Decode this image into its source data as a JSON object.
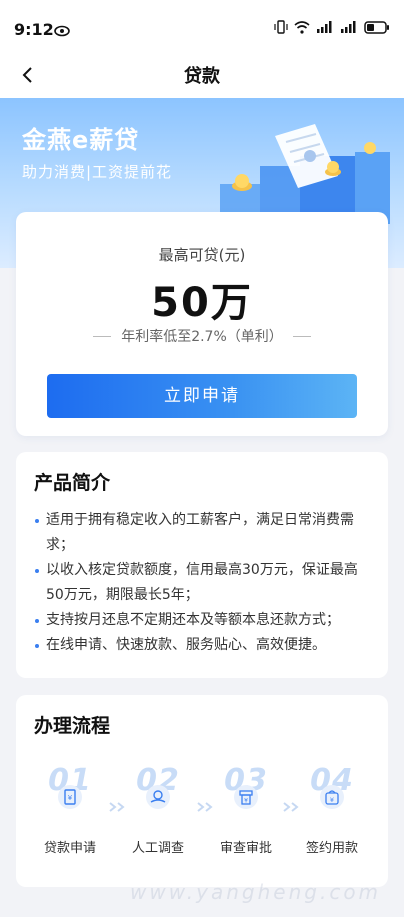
{
  "status": {
    "time": "9:12"
  },
  "nav": {
    "title": "贷款"
  },
  "hero": {
    "title": "金燕e薪贷",
    "subtitle": "助力消费|工资提前花"
  },
  "loan": {
    "label": "最高可贷(元)",
    "amount": "50万",
    "rate": "年利率低至2.7%（单利）",
    "apply_label": "立即申请"
  },
  "intro": {
    "heading": "产品简介",
    "items": [
      "适用于拥有稳定收入的工薪客户，满足日常消费需求；",
      "以收入核定贷款额度，信用最高30万元，保证最高50万元，期限最长5年；",
      "支持按月还息不定期还本及等额本息还款方式；",
      "在线申请、快速放款、服务贴心、高效便捷。"
    ]
  },
  "process": {
    "heading": "办理流程",
    "steps": [
      {
        "num": "01",
        "label": "贷款申请",
        "icon": "document-icon"
      },
      {
        "num": "02",
        "label": "人工调查",
        "icon": "hand-coin-icon"
      },
      {
        "num": "03",
        "label": "审查审批",
        "icon": "yen-receipt-icon"
      },
      {
        "num": "04",
        "label": "签约用款",
        "icon": "yen-bag-icon"
      }
    ]
  },
  "watermark": "www.yangheng.com",
  "colors": {
    "accent": "#1d6cf0",
    "hero_top": "#8cc4ff",
    "bullet": "#3b7ff0"
  }
}
